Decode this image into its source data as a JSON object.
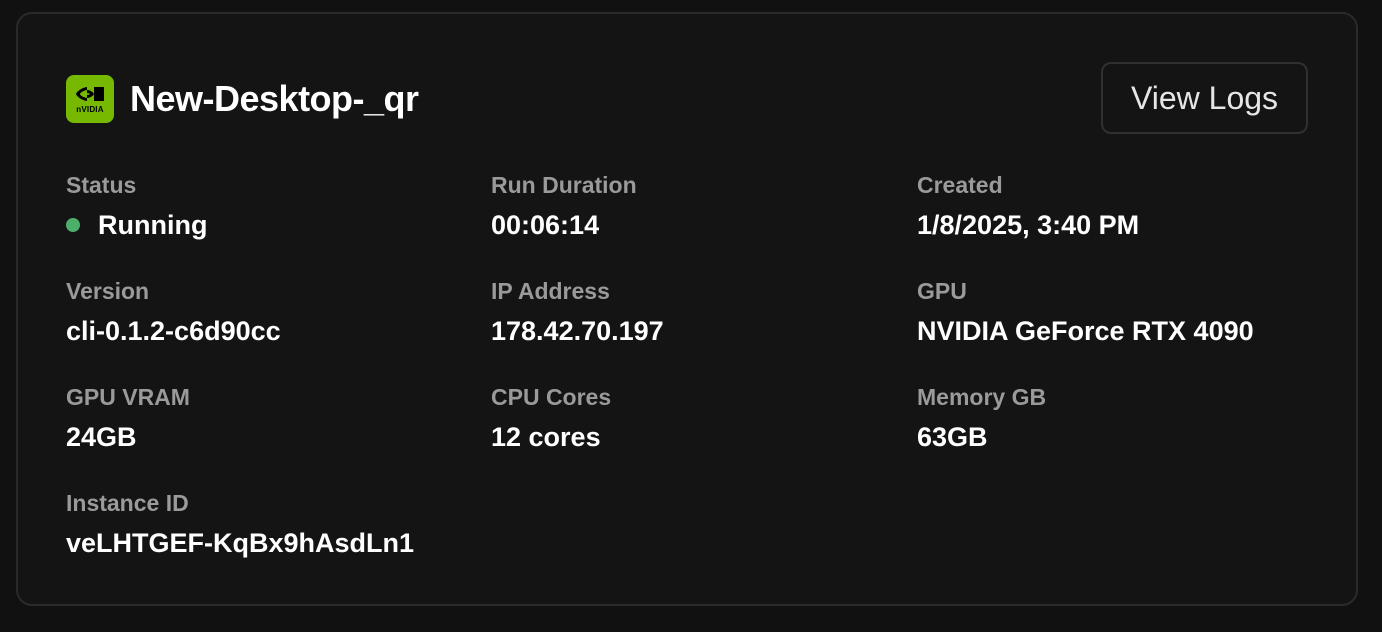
{
  "instance": {
    "name": "New-Desktop-_qr",
    "logo_text": "nVIDIA",
    "logo_icon": "nvidia-logo-icon"
  },
  "actions": {
    "view_logs_label": "View Logs"
  },
  "colors": {
    "status_running": "#4caf6a",
    "brand": "#76b900",
    "card_bg": "#141414",
    "label": "#9a9a9a"
  },
  "fields": {
    "status": {
      "label": "Status",
      "value": "Running"
    },
    "run_duration": {
      "label": "Run Duration",
      "value": "00:06:14"
    },
    "created": {
      "label": "Created",
      "value": "1/8/2025, 3:40 PM"
    },
    "version": {
      "label": "Version",
      "value": "cli-0.1.2-c6d90cc"
    },
    "ip_address": {
      "label": "IP Address",
      "value": "178.42.70.197"
    },
    "gpu": {
      "label": "GPU",
      "value": "NVIDIA GeForce RTX 4090"
    },
    "gpu_vram": {
      "label": "GPU VRAM",
      "value": "24GB"
    },
    "cpu_cores": {
      "label": "CPU Cores",
      "value": "12 cores"
    },
    "memory_gb": {
      "label": "Memory GB",
      "value": "63GB"
    },
    "instance_id": {
      "label": "Instance ID",
      "value": "veLHTGEF-KqBx9hAsdLn1"
    }
  }
}
